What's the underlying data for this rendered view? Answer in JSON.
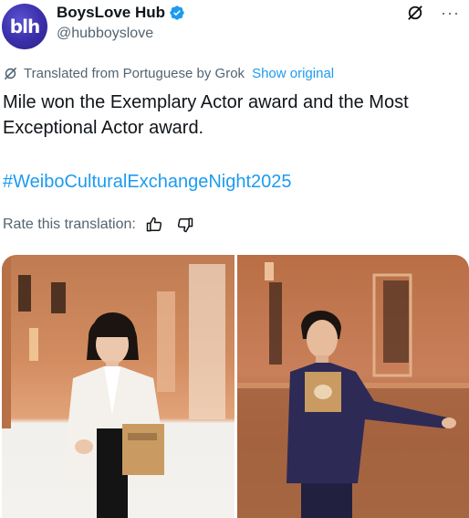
{
  "author": {
    "avatar_text": "blh",
    "name": "BoysLove Hub",
    "handle": "@hubboyslove",
    "verified": true
  },
  "translation": {
    "notice": "Translated from Portuguese by Grok",
    "show_original": "Show original"
  },
  "tweet": {
    "text": "Mile won the Exemplary Actor award and the Most Exceptional Actor award.",
    "hashtag": "#WeiboCulturalExchangeNight2025"
  },
  "rating": {
    "label": "Rate this translation:",
    "thumbs_up_icon": "thumbs-up-icon",
    "thumbs_down_icon": "thumbs-down-icon"
  },
  "media": {
    "photos": [
      {
        "subject": "man in white suit holding award book"
      },
      {
        "subject": "man in dark purple suit holding award book"
      }
    ]
  },
  "colors": {
    "accent": "#1d9bf0",
    "secondary_text": "#536471",
    "verified": "#1d9bf0",
    "avatar": "#3a2fa8"
  }
}
